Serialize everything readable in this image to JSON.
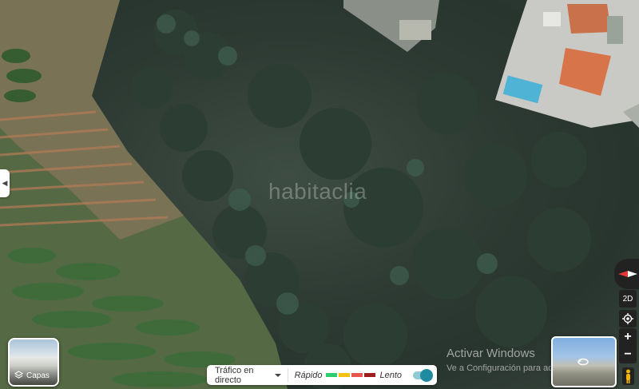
{
  "map": {
    "watermark": "habitaclia",
    "windows_activation": {
      "title": "Activar Windows",
      "subtitle": "Ve a Configuración para activar Windows."
    }
  },
  "layers_button": {
    "label": "Capas",
    "icon": "layers-icon"
  },
  "traffic_bar": {
    "menu_label": "Tráfico en directo",
    "fast_label": "Rápido",
    "slow_label": "Lento",
    "legend_colors": [
      "#2ecc71",
      "#f4c20d",
      "#e8554e",
      "#9e1c1c"
    ],
    "toggle_on": true,
    "toggle_color": "#1f8aa0"
  },
  "controls": {
    "view_mode_label": "2D",
    "zoom_in_label": "+",
    "zoom_out_label": "−",
    "compass_accent": "#e53935"
  },
  "street_view": {
    "icon": "rotate-360-icon"
  }
}
